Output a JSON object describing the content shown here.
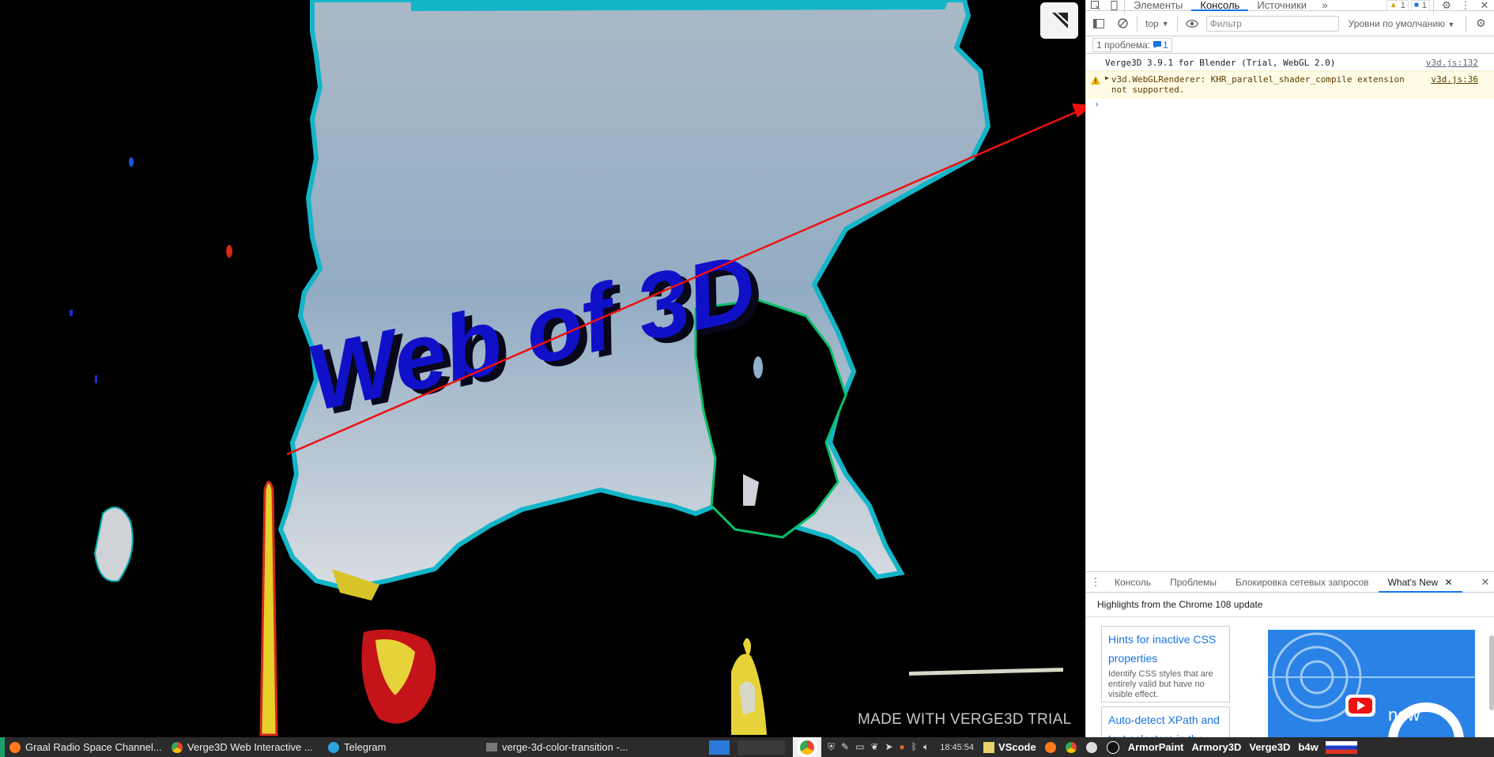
{
  "viewport": {
    "heading_3d": "Web of 3D",
    "watermark": "MADE WITH VERGE3D TRIAL",
    "colors": {
      "sky": "#93adc3",
      "text3d": "#1010c8",
      "annotation_arrow": "#ee1111"
    }
  },
  "devtools": {
    "tabs": [
      "Элементы",
      "Консоль",
      "Источники"
    ],
    "active_tab": "Консоль",
    "more_tabs_icon": "chevron-double-right-icon",
    "warnings_count": "1",
    "messages_count": "1",
    "toolbar": {
      "context": "top",
      "filter_placeholder": "Фильтр",
      "levels": "Уровни по умолчанию"
    },
    "issues": {
      "label": "1 проблема:",
      "count": "1"
    },
    "console": [
      {
        "level": "info",
        "text": "Verge3D 3.9.1 for Blender (Trial, WebGL 2.0)",
        "source": "v3d.js:132"
      },
      {
        "level": "warning",
        "text": "v3d.WebGLRenderer: KHR_parallel_shader_compile extension not supported.",
        "source": "v3d.js:36"
      }
    ],
    "prompt": "›",
    "drawer": {
      "tabs": [
        "Консоль",
        "Проблемы",
        "Блокировка сетевых запросов",
        "What's New"
      ],
      "active_tab": "What's New",
      "headline": "Highlights from the Chrome 108 update",
      "cards": [
        {
          "title": "Hints for inactive CSS properties",
          "desc": "Identify CSS styles that are entirely valid but have no visible effect."
        },
        {
          "title": "Auto-detect XPath and text selectors in the",
          "desc": ""
        }
      ],
      "promo_text": "new"
    }
  },
  "taskbar": {
    "windows": [
      {
        "icon": "firefox-icon",
        "label": "Graal Radio Space Channel..."
      },
      {
        "icon": "chrome-icon",
        "label": "Verge3D Web Interactive ..."
      },
      {
        "icon": "telegram-icon",
        "label": "Telegram"
      },
      {
        "icon": "folder-icon",
        "label": "verge-3d-color-transition -..."
      }
    ],
    "clock": "18:45:54",
    "launchers": [
      "VScode",
      "ArmorPaint",
      "Armory3D",
      "Verge3D",
      "b4w"
    ]
  }
}
